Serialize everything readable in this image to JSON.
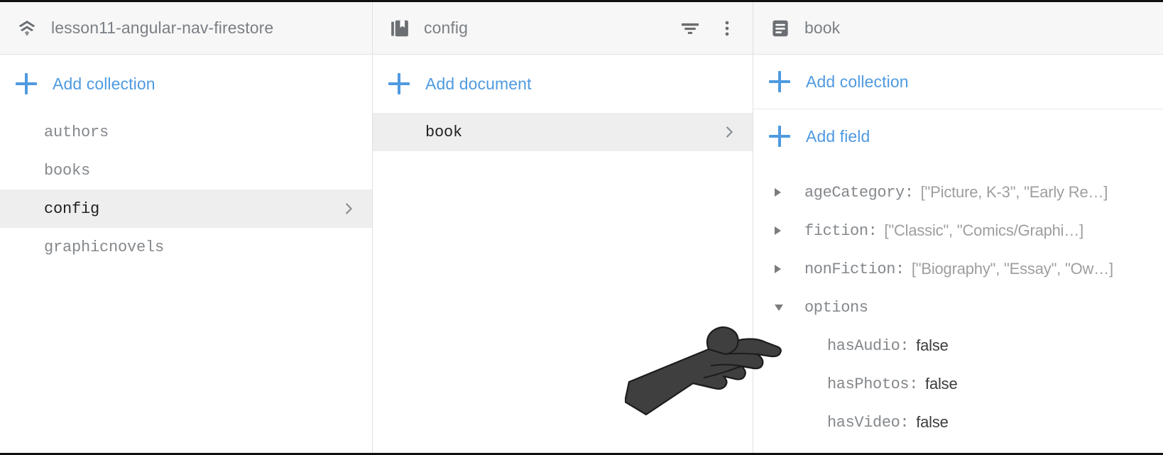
{
  "columns": {
    "root": {
      "header": {
        "icon": "firestore-root-icon",
        "title": "lesson11-angular-nav-firestore"
      },
      "add_label": "Add collection",
      "items": [
        {
          "label": "authors",
          "selected": false
        },
        {
          "label": "books",
          "selected": false
        },
        {
          "label": "config",
          "selected": true
        },
        {
          "label": "graphicnovels",
          "selected": false
        }
      ]
    },
    "documents": {
      "header": {
        "icon": "collection-icon",
        "title": "config",
        "actions": [
          {
            "icon": "filter-icon",
            "label": "Filter"
          },
          {
            "icon": "more-vert-icon",
            "label": "More options"
          }
        ]
      },
      "add_label": "Add document",
      "items": [
        {
          "label": "book",
          "selected": true
        }
      ]
    },
    "fields": {
      "header": {
        "icon": "document-icon",
        "title": "book"
      },
      "add_collection_label": "Add collection",
      "add_field_label": "Add field",
      "rows": [
        {
          "toggle": "closed",
          "key": "ageCategory:",
          "value": "[\"Picture, K-3\", \"Early Re…]",
          "nested": false
        },
        {
          "toggle": "closed",
          "key": "fiction:",
          "value": "[\"Classic\", \"Comics/Graphi…]",
          "nested": false
        },
        {
          "toggle": "closed",
          "key": "nonFiction:",
          "value": "[\"Biography\", \"Essay\", \"Ow…]",
          "nested": false
        },
        {
          "toggle": "open",
          "key": "options",
          "value": "",
          "nested": false
        },
        {
          "toggle": "none",
          "key": "hasAudio:",
          "value": "false",
          "nested": true
        },
        {
          "toggle": "none",
          "key": "hasPhotos:",
          "value": "false",
          "nested": true
        },
        {
          "toggle": "none",
          "key": "hasVideo:",
          "value": "false",
          "nested": true
        }
      ]
    }
  },
  "cursor": {
    "kind": "pointing-hand-cursor",
    "color": "#3f3f3f"
  },
  "colors": {
    "accent": "#4f9ae0",
    "header_bg": "#f7f7f7",
    "selected_row_bg": "#eeeeee",
    "text_muted": "#84888c",
    "text_value": "#9e9e9e"
  }
}
